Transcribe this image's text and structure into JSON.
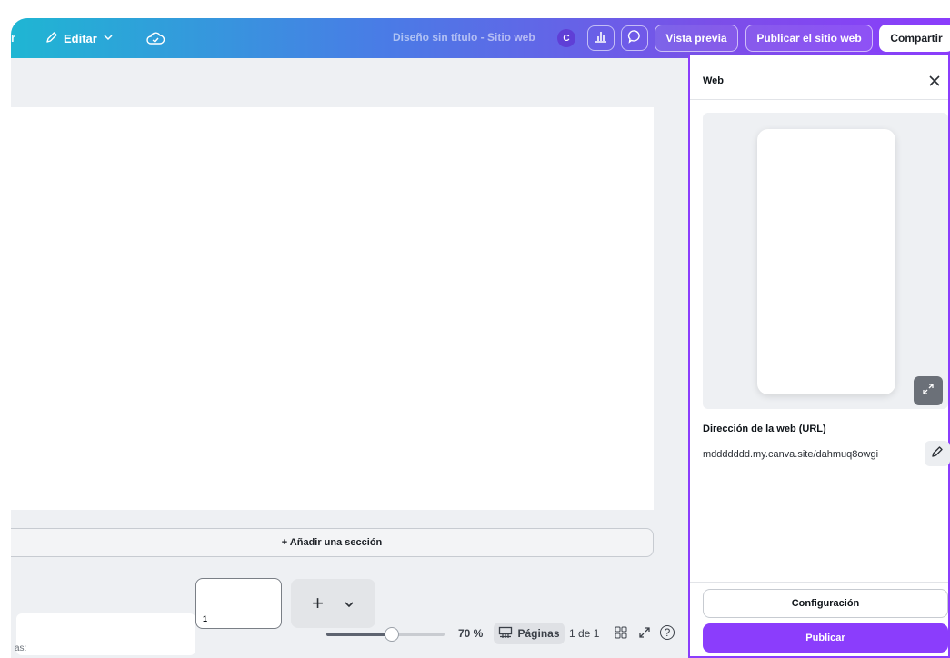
{
  "topbar": {
    "ghost_text": "r",
    "edit_label": "Editar",
    "doc_title": "Diseño sin título - Sitio web",
    "avatar_initial": "C",
    "preview_label": "Vista previa",
    "publish_site_label": "Publicar el sitio web",
    "share_label": "Compartir"
  },
  "canvas": {
    "add_section_label": "+ Añadir una sección",
    "thumb_number": "1",
    "add_page_plus": "+",
    "add_page_chevron": "⌄",
    "notes_ghost": "as:"
  },
  "statusbar": {
    "zoom_label": "70 %",
    "zoom_value": 0.55,
    "pages_label": "Páginas",
    "page_count": "1 de 1",
    "help": "?"
  },
  "panel": {
    "title": "Web",
    "url_label": "Dirección de la web (URL)",
    "url_value": "mddddddd.my.canva.site/dahmuq8owgi",
    "config_label": "Configuración",
    "publish_label": "Publicar"
  },
  "colors": {
    "accent": "#8b3dfc",
    "gradient_start": "#1fb6d3",
    "gradient_end": "#8b3dfc"
  }
}
